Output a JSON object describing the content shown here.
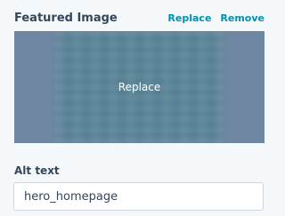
{
  "featured_image": {
    "title": "Featured Image",
    "replace_label": "Replace",
    "remove_label": "Remove",
    "overlay_label": "Replace"
  },
  "alt_text": {
    "label": "Alt text",
    "value": "hero_homepage"
  },
  "colors": {
    "link": "#0091ae",
    "heading": "#33475b",
    "image_background": "#6f87a2",
    "image_center": "#5a8699"
  }
}
